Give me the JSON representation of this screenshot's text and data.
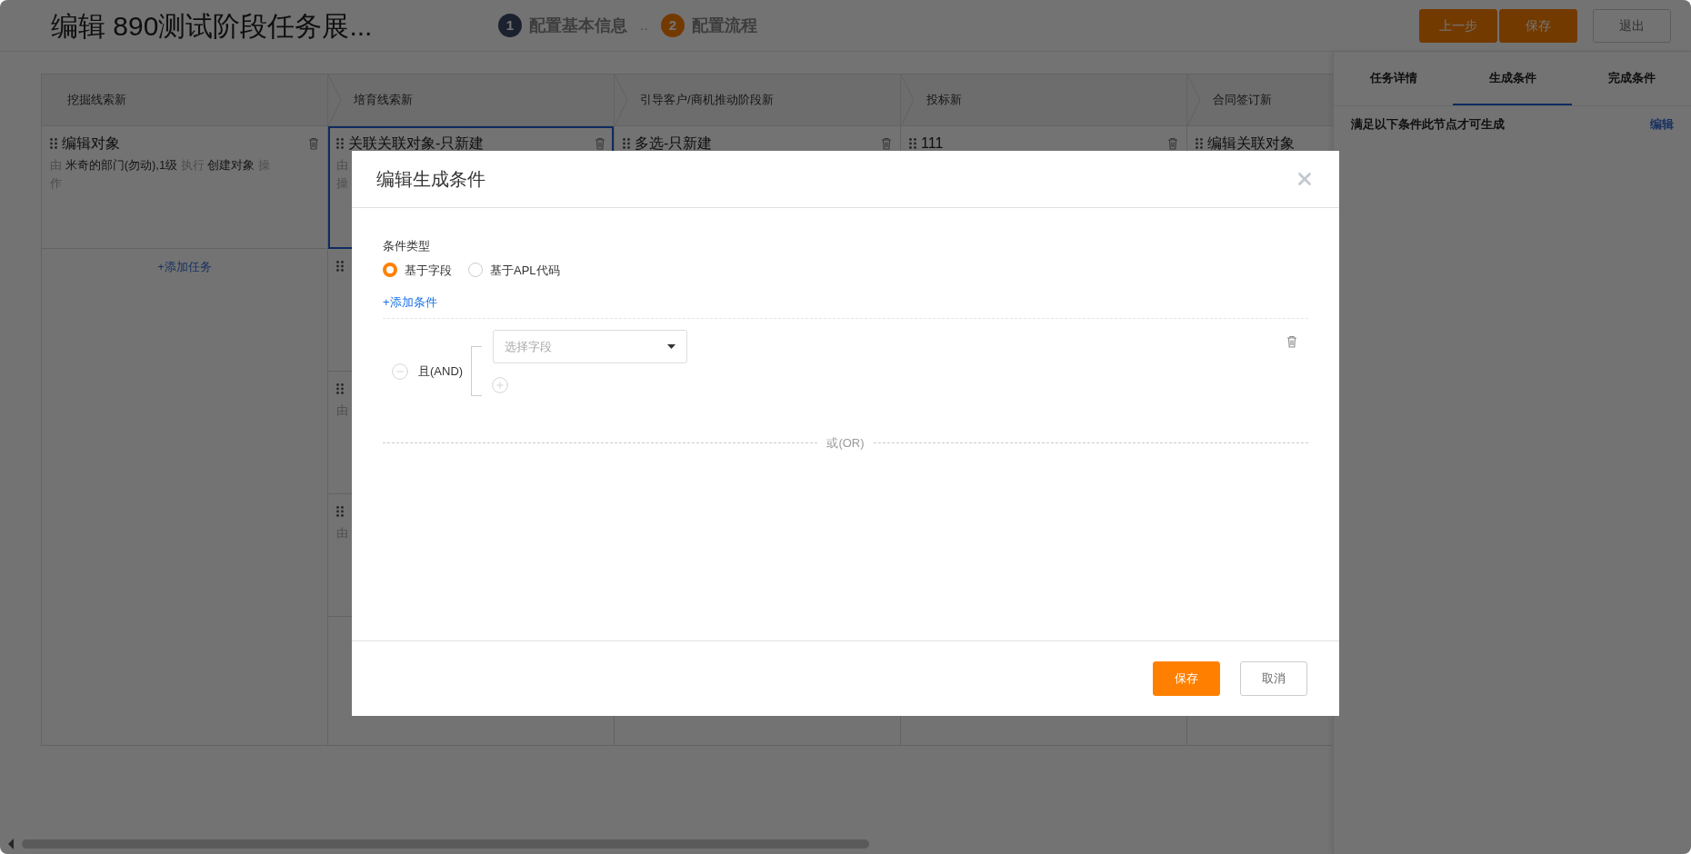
{
  "header": {
    "title": "编辑 890测试阶段任务展...",
    "steps": [
      {
        "number": "1",
        "label": "配置基本信息",
        "selected": false
      },
      {
        "number": "2",
        "label": "配置流程",
        "selected": true
      }
    ],
    "step_separator": "..",
    "buttons": [
      {
        "label": "上一步",
        "kind": "primary"
      },
      {
        "label": "保存",
        "kind": "primary"
      },
      {
        "label": "退出",
        "kind": "default"
      }
    ]
  },
  "board": {
    "columns": [
      {
        "header": "挖掘线索新",
        "add_task": "+添加任务",
        "cards": [
          {
            "title": "编辑对象",
            "selected": false,
            "trash": true,
            "detail": [
              [
                {
                  "text": "由",
                  "muted": true
                },
                {
                  "text": "米奇的部门(勿动),1级",
                  "muted": false
                },
                {
                  "text": "执行",
                  "muted": true
                },
                {
                  "text": "创建对象",
                  "muted": false
                },
                {
                  "text": "操",
                  "muted": true
                }
              ],
              [
                {
                  "text": "作",
                  "muted": true
                }
              ]
            ]
          }
        ]
      },
      {
        "header": "培育线索新",
        "cards": [
          {
            "title": "关联关联对象-只新建",
            "selected": true,
            "trash": true,
            "detail": [
              [
                {
                  "text": "由",
                  "muted": true
                }
              ],
              [
                {
                  "text": "操",
                  "muted": true
                }
              ]
            ]
          },
          {
            "selected": false
          },
          {
            "selected": false,
            "detail": [
              [
                {
                  "text": "由",
                  "muted": true
                }
              ]
            ]
          },
          {
            "selected": false,
            "detail": [
              [
                {
                  "text": "由",
                  "muted": true
                }
              ]
            ]
          }
        ]
      },
      {
        "header": "引导客户/商机推动阶段新",
        "cards": [
          {
            "title": "多选-只新建",
            "selected": false,
            "trash": true
          }
        ]
      },
      {
        "header": "投标新",
        "cards": [
          {
            "title": "111",
            "selected": false,
            "trash": true
          }
        ]
      },
      {
        "header": "合同签订新",
        "cards": [
          {
            "title": "编辑关联对象",
            "selected": false
          }
        ]
      }
    ]
  },
  "side_panel": {
    "tabs": [
      {
        "label": "任务详情",
        "selected": false
      },
      {
        "label": "生成条件",
        "selected": true
      },
      {
        "label": "完成条件",
        "selected": false
      }
    ],
    "note": "满足以下条件此节点才可生成",
    "edit_link": "编辑"
  },
  "modal": {
    "title": "编辑生成条件",
    "condition_type_label": "条件类型",
    "radios": [
      {
        "label": "基于字段",
        "selected": true
      },
      {
        "label": "基于APL代码",
        "selected": false
      }
    ],
    "add_condition": "+添加条件",
    "group": {
      "operator": "且(AND)",
      "field": {
        "placeholder": "选择字段"
      }
    },
    "or_divider": "或(OR)",
    "buttons": [
      {
        "label": "保存",
        "kind": "primary"
      },
      {
        "label": "取消",
        "kind": "default"
      }
    ]
  }
}
